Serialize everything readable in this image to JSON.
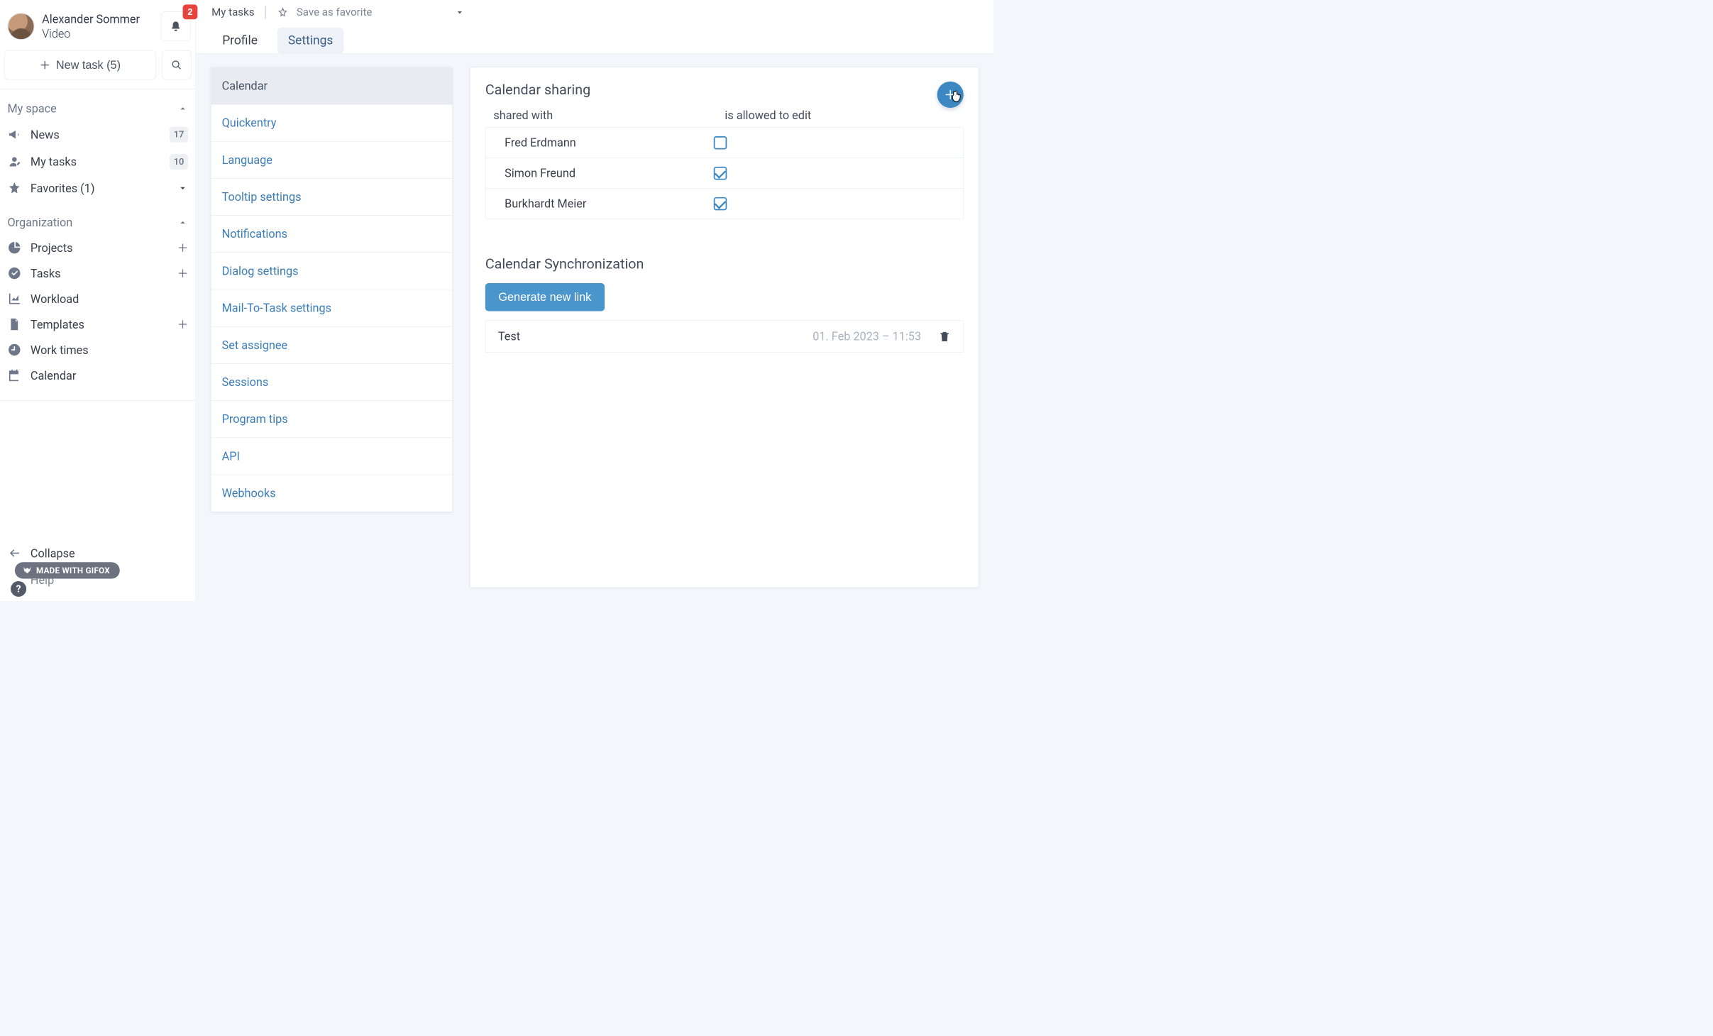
{
  "user": {
    "name": "Alexander Sommer",
    "sub": "Video"
  },
  "bell_count": "2",
  "new_task_label": "New task (5)",
  "my_space": {
    "title": "My space",
    "items": [
      {
        "label": "News",
        "badge": "17"
      },
      {
        "label": "My tasks",
        "badge": "10"
      },
      {
        "label": "Favorites (1)"
      }
    ]
  },
  "org": {
    "title": "Organization",
    "items": [
      {
        "label": "Projects",
        "trail": "plus"
      },
      {
        "label": "Tasks",
        "trail": "plus"
      },
      {
        "label": "Workload"
      },
      {
        "label": "Templates",
        "trail": "plus"
      },
      {
        "label": "Work times"
      },
      {
        "label": "Calendar"
      }
    ]
  },
  "footer": {
    "collapse": "Collapse",
    "help": "Help"
  },
  "gifox": "MADE WITH GIFOX",
  "crumb_root": "My tasks",
  "save_fav": "Save as favorite",
  "tabs": {
    "profile": "Profile",
    "settings": "Settings"
  },
  "settings_nav": [
    "Calendar",
    "Quickentry",
    "Language",
    "Tooltip settings",
    "Notifications",
    "Dialog settings",
    "Mail-To-Task settings",
    "Set assignee",
    "Sessions",
    "Program tips",
    "API",
    "Webhooks"
  ],
  "sharing": {
    "title": "Calendar sharing",
    "col1": "shared with",
    "col2": "is allowed to edit",
    "rows": [
      {
        "name": "Fred Erdmann",
        "checked": false
      },
      {
        "name": "Simon Freund",
        "checked": true
      },
      {
        "name": "Burkhardt Meier",
        "checked": true
      }
    ]
  },
  "sync": {
    "title": "Calendar Synchronization",
    "button": "Generate new link",
    "rows": [
      {
        "name": "Test",
        "date": "01. Feb 2023 – 11:53"
      }
    ]
  }
}
